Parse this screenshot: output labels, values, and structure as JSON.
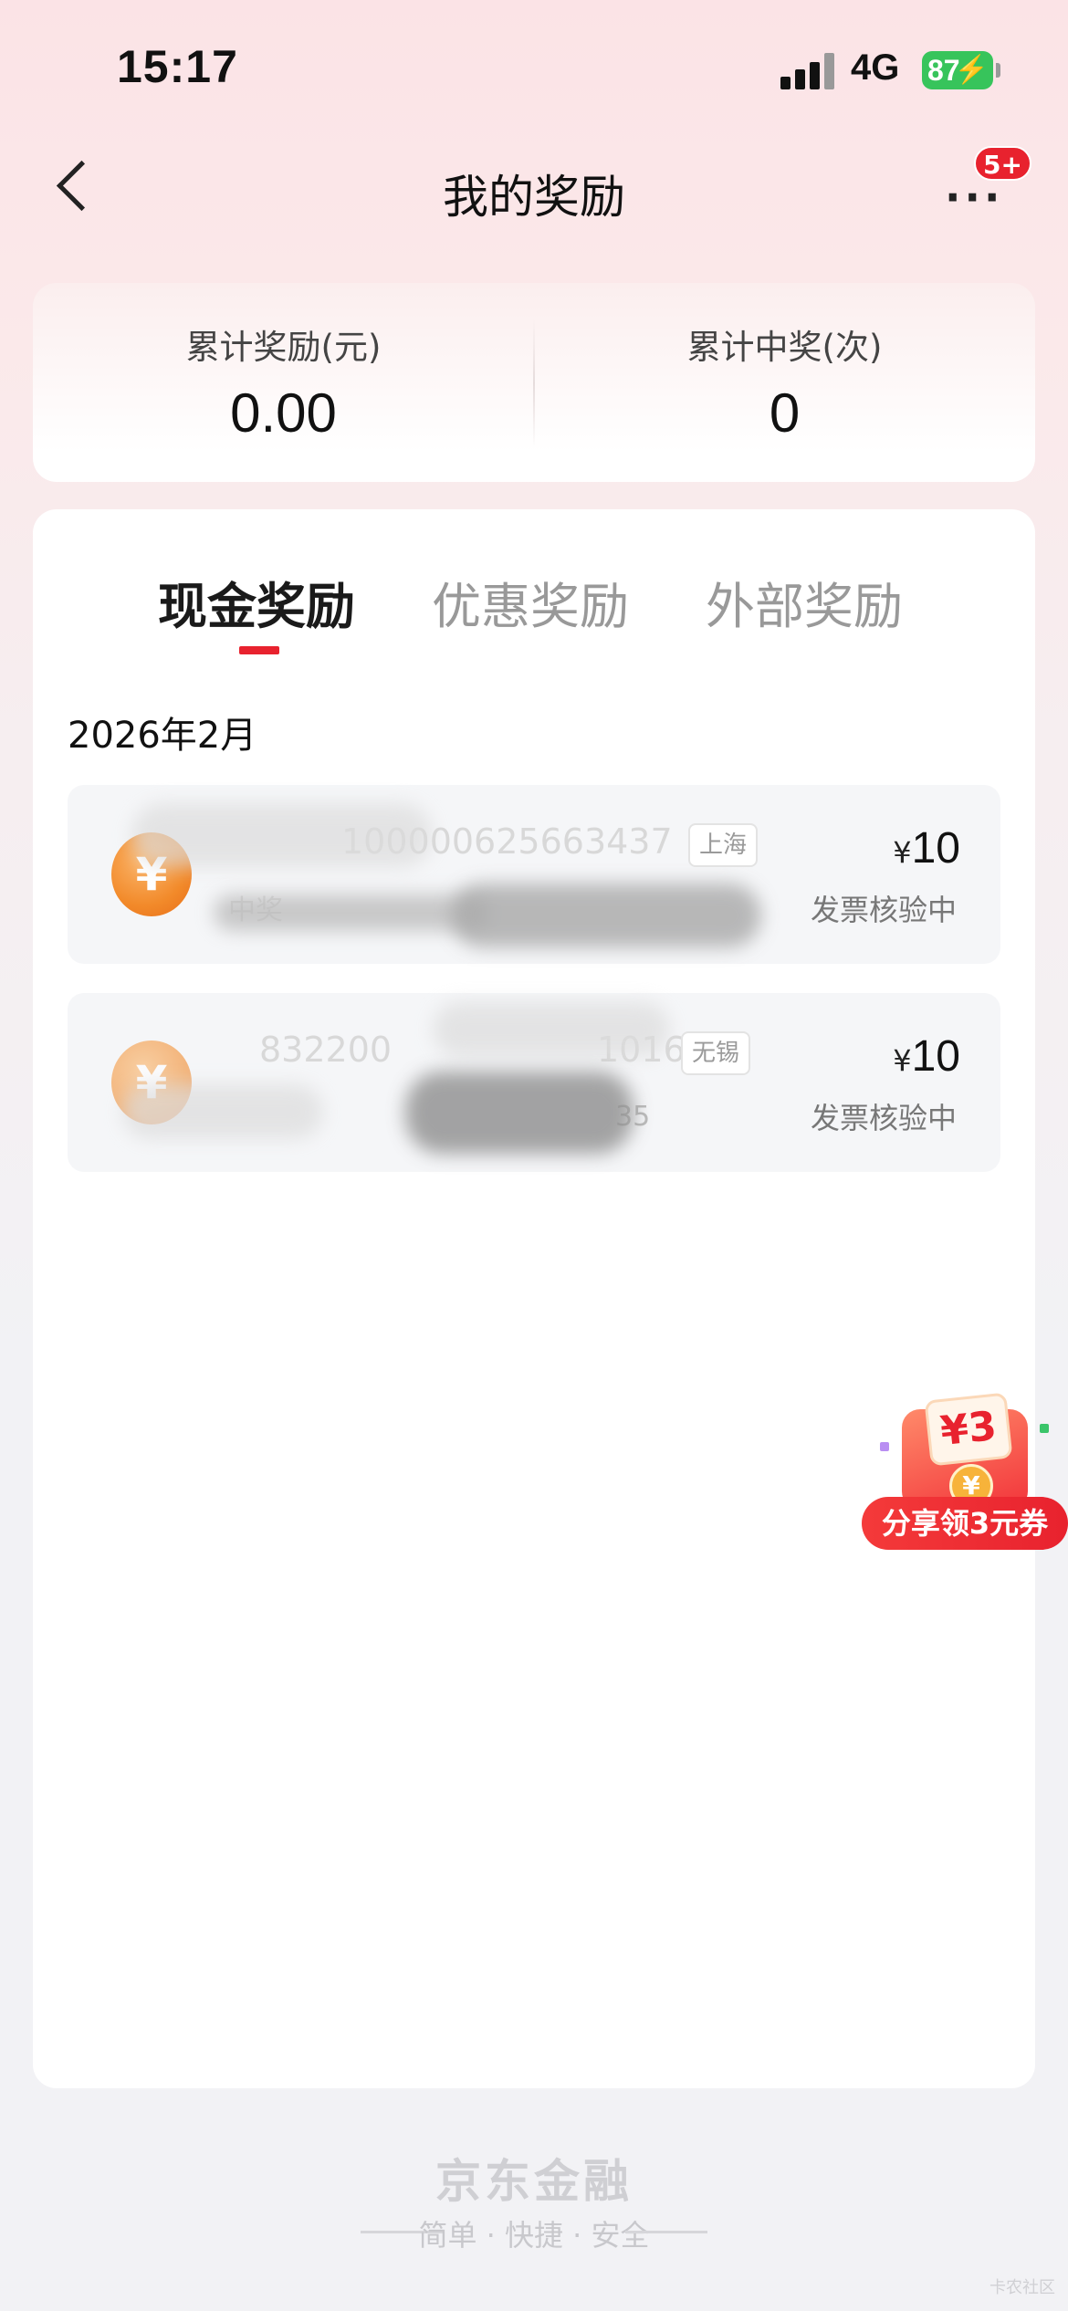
{
  "status_bar": {
    "time": "15:17",
    "network": "4G",
    "battery": "87"
  },
  "nav": {
    "title": "我的奖励",
    "more_badge": "5+"
  },
  "summary": {
    "total_reward_label": "累计奖励(元)",
    "total_reward_value": "0.00",
    "total_wins_label": "累计中奖(次)",
    "total_wins_value": "0"
  },
  "tabs": [
    {
      "label": "现金奖励",
      "active": true
    },
    {
      "label": "优惠奖励",
      "active": false
    },
    {
      "label": "外部奖励",
      "active": false
    }
  ],
  "month": "2026年2月",
  "records": [
    {
      "visible_id": "100000625663437",
      "visible_sub": "中奖",
      "city": "上海",
      "currency": "¥",
      "amount": "10",
      "status": "发票核验中"
    },
    {
      "visible_id": "832200",
      "visible_id_tail": "1016",
      "visible_sub": "35",
      "city": "无锡",
      "currency": "¥",
      "amount": "10",
      "status": "发票核验中"
    }
  ],
  "promo": {
    "coupon_text": "¥3",
    "coin_symbol": "¥",
    "label": "分享领3元券"
  },
  "footer": {
    "brand": "京东金融",
    "slogan": "简单 · 快捷 · 安全"
  },
  "watermark": "卡农社区",
  "colors": {
    "accent_red": "#e8222e",
    "coin_orange": "#f28a2a",
    "battery_green": "#37c45b"
  }
}
